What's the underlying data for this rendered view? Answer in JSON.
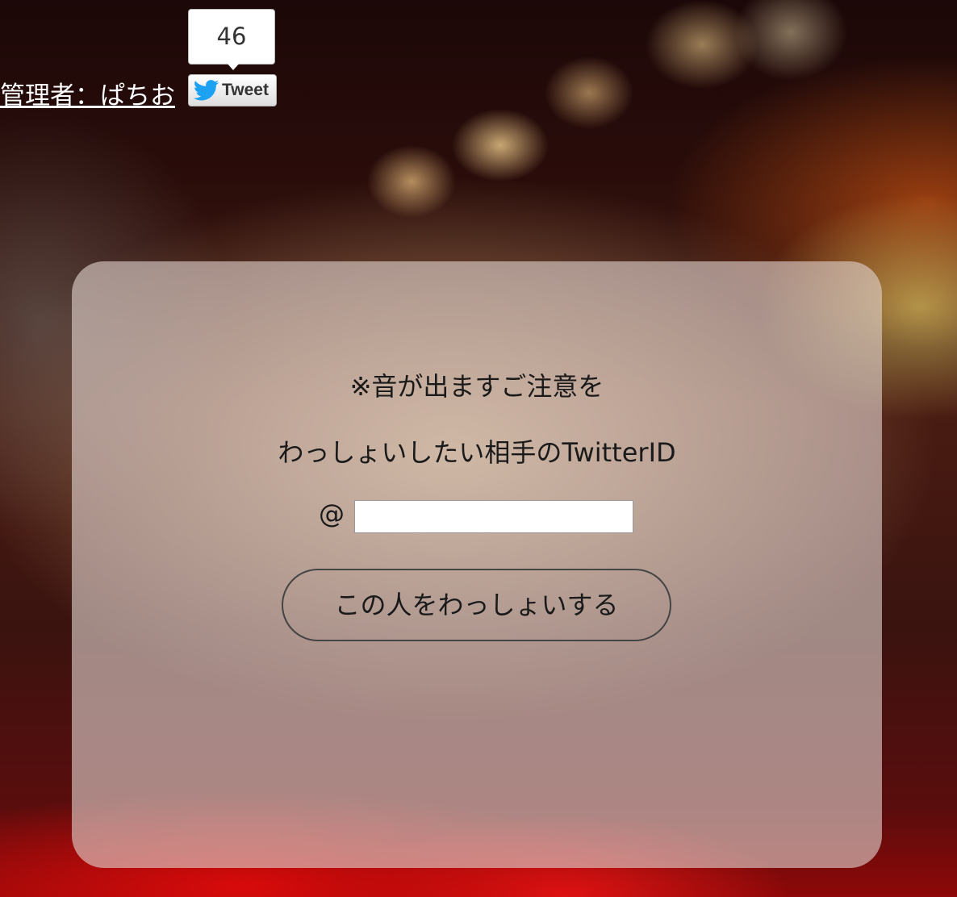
{
  "header": {
    "admin_link": "管理者：ぱちお",
    "tweet_count": "46",
    "tweet_label": "Tweet"
  },
  "form": {
    "notice": "※音が出ますご注意を",
    "prompt": "わっしょいしたい相手のTwitterID",
    "at_symbol": "@",
    "twitter_id_value": "",
    "submit_label": "この人をわっしょいする"
  },
  "colors": {
    "twitter_blue": "#1da1f2",
    "panel_overlay": "rgba(225,210,205,0.62)",
    "link_text": "#ffffff"
  },
  "icons": {
    "tweet_button_icon": "twitter-bird-icon"
  }
}
